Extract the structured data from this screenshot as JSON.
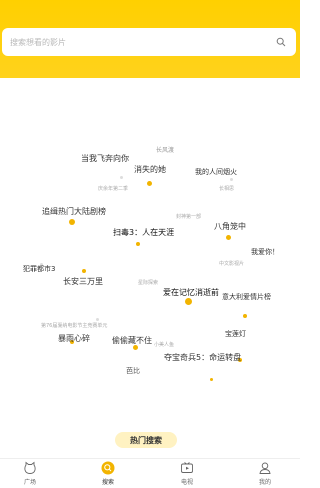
{
  "search": {
    "placeholder": "搜索想看的影片"
  },
  "cloud": {
    "words": [
      "长风渡",
      "当我飞奔向你",
      "消失的她",
      "我的人间烟火",
      "长相思",
      "庆余年第二季",
      "孤注一掷",
      "边境",
      "超能一家人",
      "速度与激情10",
      "追缉热门大陆剧榜",
      "八角笼中",
      "扫毒3：人在天涯",
      "我爱你！",
      "封神第一部",
      "犯罪都市3",
      "中文影视片",
      "长安三万里",
      "星际探索",
      "热门影视",
      "爱在记忆消逝前",
      "意大利电影",
      "意大利爱情片榜",
      "第76届戛纳电影节主竞赛单元",
      "宝莲灯",
      "暴雨心碎",
      "偷偷藏不住",
      "小美人鱼",
      "八角笼中续集",
      "夺宝奇兵5：命运转盘",
      "芭比"
    ]
  },
  "hot_label": "热门搜索",
  "tabbar": {
    "tabs": [
      {
        "label": "广场"
      },
      {
        "label": "搜索"
      },
      {
        "label": "电视"
      },
      {
        "label": "我的"
      }
    ]
  },
  "colors": {
    "accent": "#ffd000",
    "dot": "#f2b400",
    "text_dark": "#333333",
    "text_light": "#aaaaaa"
  }
}
